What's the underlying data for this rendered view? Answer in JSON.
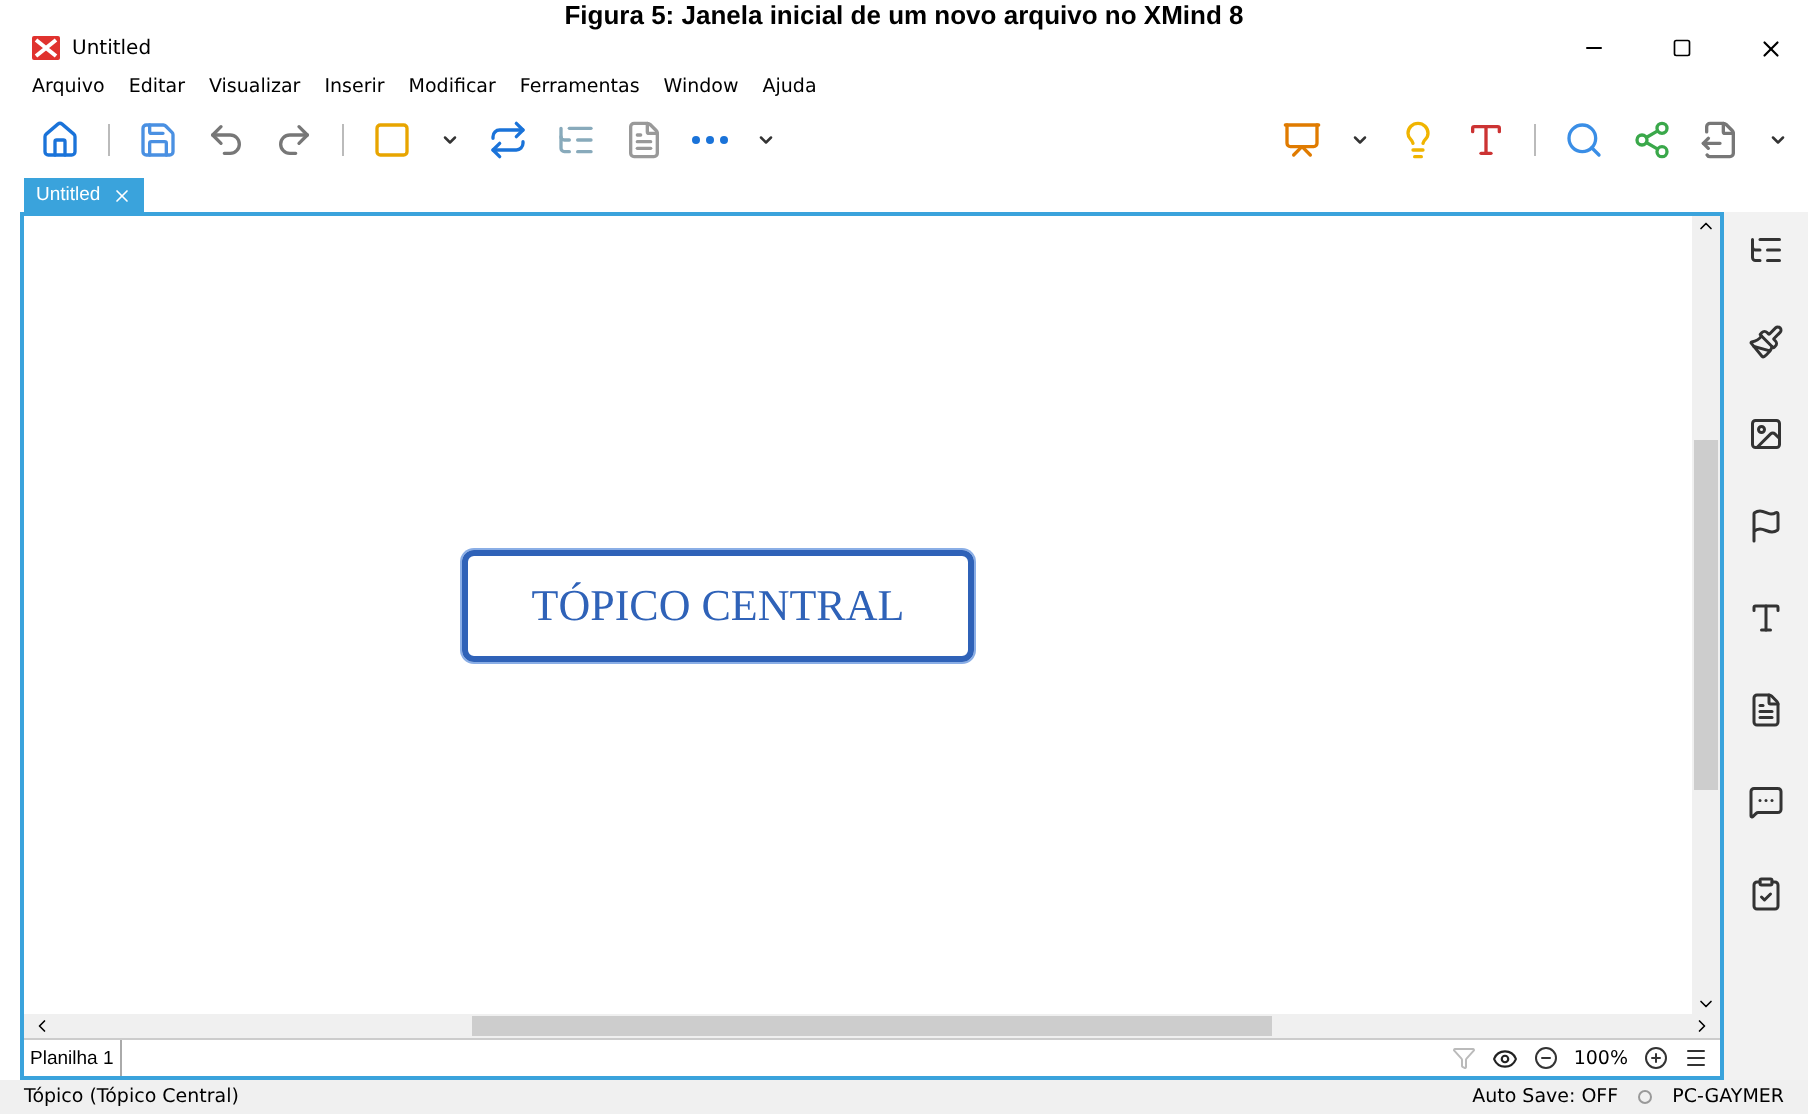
{
  "caption": "Figura 5: Janela inicial de um novo arquivo no XMind 8",
  "window": {
    "title": "Untitled"
  },
  "menu": [
    "Arquivo",
    "Editar",
    "Visualizar",
    "Inserir",
    "Modificar",
    "Ferramentas",
    "Window",
    "Ajuda"
  ],
  "tabs": [
    {
      "label": "Untitled",
      "selected": true
    }
  ],
  "topic": {
    "label": "TÓPICO CENTRAL"
  },
  "sheets": [
    {
      "label": "Planilha 1",
      "selected": true
    }
  ],
  "zoom": "100%",
  "status_bar": {
    "selection": "Tópico (Tópico Central)",
    "autosave": "Auto Save: OFF",
    "user": "PC-GAYMER"
  }
}
